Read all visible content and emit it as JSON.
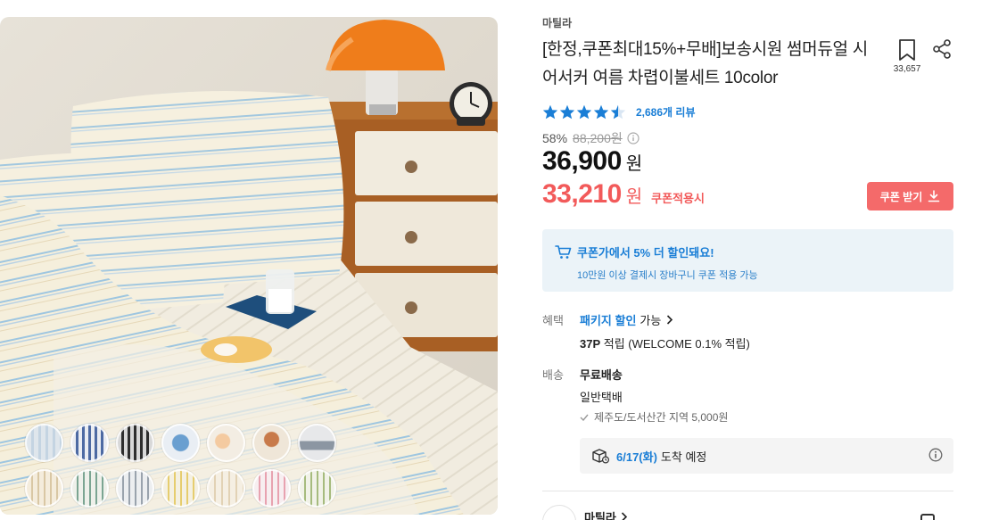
{
  "product": {
    "brand": "마틸라",
    "title": "[한정,쿠폰최대15%+무배]보송시원 썸머듀얼 시어서커 여름 차렵이불세트 10color",
    "bookmark_count": "33,657",
    "review_count": "2,686개 리뷰",
    "rating": 4.5
  },
  "price": {
    "discount_rate": "58%",
    "original": "88,200원",
    "sale": "36,900",
    "unit": "원",
    "coupon_price": "33,210",
    "coupon_unit": "원",
    "coupon_applied": "쿠폰적용시",
    "coupon_button": "쿠폰 받기"
  },
  "coupon_banner": {
    "title": "쿠폰가에서 5% 더 할인돼요!",
    "subtitle": "10만원 이상 결제시 장바구니 쿠폰 적용 가능"
  },
  "benefit": {
    "label": "혜택",
    "package_link": "패키지 할인",
    "package_tail": "가능",
    "points_amount": "37P",
    "points_text": " 적립 (WELCOME 0.1% 적립)"
  },
  "shipping": {
    "label": "배송",
    "type": "무료배송",
    "method": "일반택배",
    "jeju": "제주도/도서산간 지역 5,000원",
    "delivery_date": "6/17(화)",
    "delivery_text": "도착 예정"
  },
  "seller": {
    "name": "마틸라"
  },
  "colors": {
    "accent_blue": "#1a7ed6",
    "coupon_red": "#f25a5a",
    "star": "#1a7ed6",
    "banner_bg": "#ebf3f8"
  },
  "icons": [
    "bookmark-icon",
    "share-icon",
    "star-icon",
    "info-icon",
    "download-icon",
    "cart-icon",
    "chevron-right-icon",
    "check-icon",
    "delivery-box-icon"
  ],
  "swatches": [
    {
      "name": "light-blue-check"
    },
    {
      "name": "navy-stripe"
    },
    {
      "name": "black-stripe"
    },
    {
      "name": "blue-pattern"
    },
    {
      "name": "beige-floral"
    },
    {
      "name": "brown-pattern"
    },
    {
      "name": "gray-tree"
    },
    {
      "name": "beige-stripe"
    },
    {
      "name": "green-stripe"
    },
    {
      "name": "gray-stripe"
    },
    {
      "name": "yellow-stripe"
    },
    {
      "name": "beige-plain-stripe"
    },
    {
      "name": "pink-stripe"
    },
    {
      "name": "olive-stripe"
    }
  ]
}
